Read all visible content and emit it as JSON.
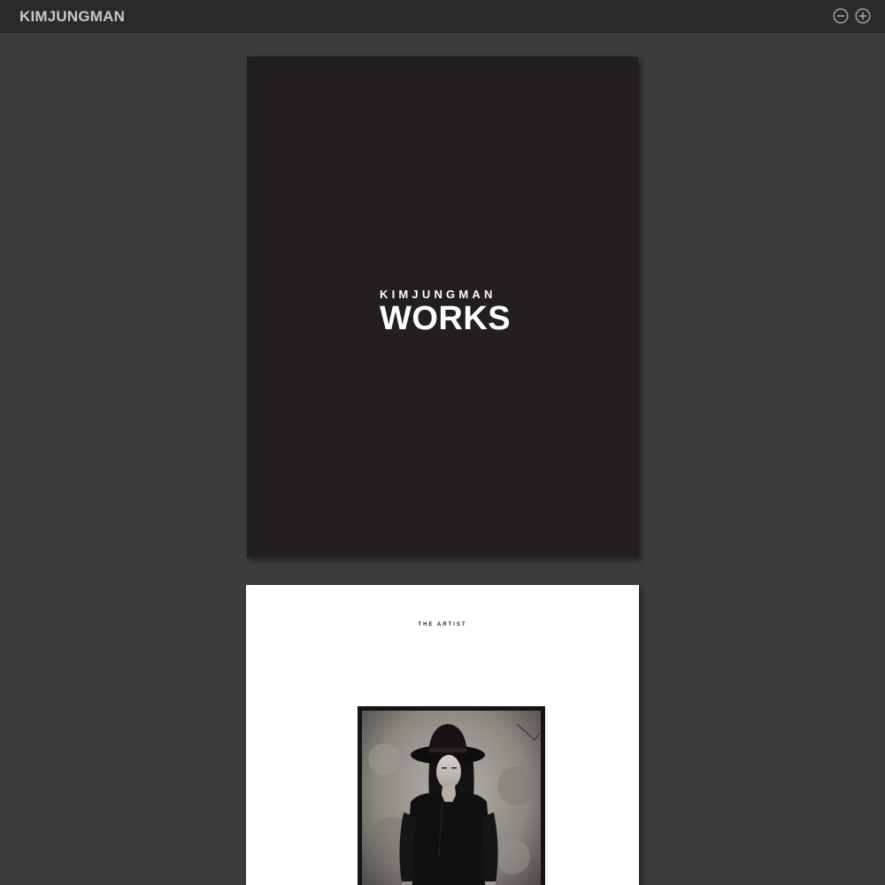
{
  "app": {
    "title": "KIMJUNGMAN"
  },
  "toolbar": {
    "zoom_out_icon": "minus-circle-icon",
    "zoom_in_icon": "plus-circle-icon"
  },
  "pages": {
    "cover": {
      "subtitle": "KIMJUNGMAN",
      "title": "WORKS",
      "background": "#231f20"
    },
    "artist": {
      "heading": "THE ARTIST",
      "photo_icon": "artist-portrait-photo"
    }
  },
  "colors": {
    "viewer_background": "#3c3c3c",
    "topbar_background": "#2a2a2a",
    "title_text": "#c9c9c9"
  }
}
